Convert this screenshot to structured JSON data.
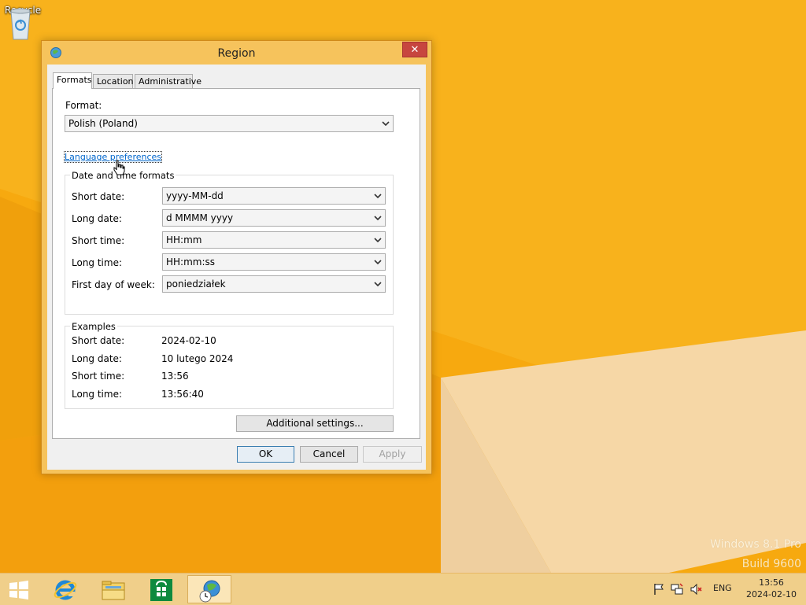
{
  "desktop": {
    "recycle_label": "Recycle",
    "watermark_line1": "Windows 8.1 Pro",
    "watermark_line2": "Build 9600"
  },
  "dialog": {
    "title": "Region",
    "close_glyph": "✕",
    "tabs": [
      {
        "label": "Formats",
        "active": true
      },
      {
        "label": "Location",
        "active": false
      },
      {
        "label": "Administrative",
        "active": false
      }
    ],
    "format_label": "Format:",
    "format_value": "Polish (Poland)",
    "language_link": "Language preferences",
    "datetime_group": {
      "title": "Date and time formats",
      "rows": [
        {
          "label": "Short date:",
          "value": "yyyy-MM-dd"
        },
        {
          "label": "Long date:",
          "value": "d MMMM yyyy"
        },
        {
          "label": "Short time:",
          "value": "HH:mm"
        },
        {
          "label": "Long time:",
          "value": "HH:mm:ss"
        },
        {
          "label": "First day of week:",
          "value": "poniedziałek"
        }
      ]
    },
    "examples_group": {
      "title": "Examples",
      "rows": [
        {
          "label": "Short date:",
          "value": "2024-02-10"
        },
        {
          "label": "Long date:",
          "value": "10 lutego 2024"
        },
        {
          "label": "Short time:",
          "value": "13:56"
        },
        {
          "label": "Long time:",
          "value": "13:56:40"
        }
      ]
    },
    "additional_settings": "Additional settings...",
    "ok": "OK",
    "cancel": "Cancel",
    "apply": "Apply"
  },
  "taskbar": {
    "language": "ENG",
    "time": "13:56",
    "date": "2024-02-10",
    "icons": [
      "windows-start-icon",
      "internet-explorer-icon",
      "file-explorer-icon",
      "windows-store-icon",
      "region-globe-icon"
    ],
    "tray_icons": [
      "action-center-flag-icon",
      "network-icon",
      "volume-muted-icon"
    ]
  },
  "colors": {
    "desktop_orange": "#f7a90f",
    "dialog_frame": "#f6c35c",
    "close_red": "#c7463f",
    "link_blue": "#0066cc",
    "taskbar": "#f0cf8a"
  }
}
